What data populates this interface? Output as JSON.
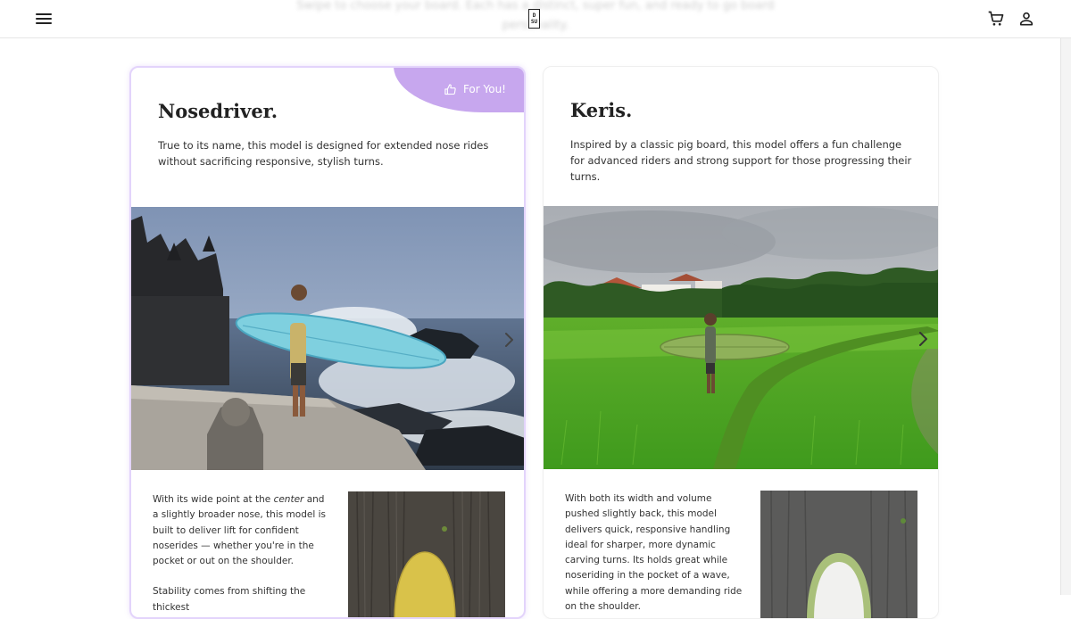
{
  "header": {
    "ghost_text": "Swipe to choose your board. Each has a distinct, super fun, and ready to go board personality.",
    "logo_top": "D",
    "logo_bottom": "SU"
  },
  "icons": {
    "menu": "hamburger-menu-icon",
    "cart": "shopping-cart-icon",
    "account": "user-account-icon",
    "badge": "thumbs-up-icon",
    "next": "chevron-right-icon"
  },
  "colors": {
    "badge_bg": "#c7a7ee",
    "featured_border": "#e3d4fb"
  },
  "cards": [
    {
      "badge": "For You!",
      "title": "Nosedriver.",
      "description": "True to its name, this model is designed for extended nose rides without sacrificing responsive, stylish turns.",
      "detail_1_before": "With its wide point at the ",
      "detail_1_em": "center",
      "detail_1_after": " and a slightly broader nose, this model is built to deliver lift for confident noserides — whether you're in the pocket or out on the shoulder.",
      "detail_2": "Stability comes from shifting the thickest"
    },
    {
      "title": "Keris.",
      "description": "Inspired by a classic pig board, this model offers a fun challenge for advanced riders and strong support for those progressing their turns.",
      "detail_1": "With both its width and volume pushed slightly back, this model delivers quick, responsive handling ideal for sharper, more dynamic carving turns. Its holds great while noseriding in the pocket of a wave, while offering a more demanding ride on the shoulder."
    }
  ]
}
